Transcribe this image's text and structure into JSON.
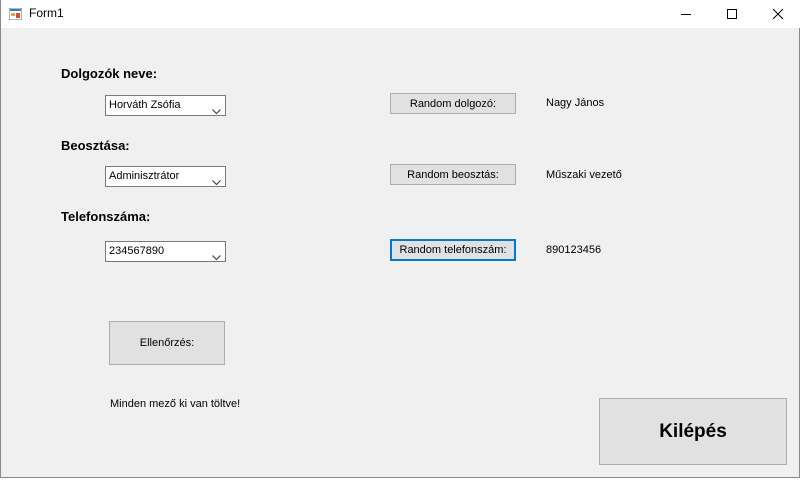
{
  "window": {
    "title": "Form1",
    "icon": "winforms-app-icon",
    "controls": {
      "minimize_icon": "minimize-icon",
      "maximize_icon": "maximize-icon",
      "close_icon": "close-icon"
    }
  },
  "employee": {
    "label": "Dolgozók neve:",
    "selected": "Horváth Zsófia",
    "random_button": "Random dolgozó:",
    "random_result": "Nagy János"
  },
  "position": {
    "label": "Beosztása:",
    "selected": "Adminisztrátor",
    "random_button": "Random beosztás:",
    "random_result": "Műszaki vezető"
  },
  "phone": {
    "label": "Telefonszáma:",
    "selected": "234567890",
    "random_button": "Random telefonszám:",
    "random_result": "890123456"
  },
  "check_button": "Ellenőrzés:",
  "status_message": "Minden mező ki van töltve!",
  "exit_button": "Kilépés",
  "colors": {
    "form_background": "#f0f0f0",
    "button_background": "#e1e1e1",
    "focus_border": "#0078d7"
  }
}
